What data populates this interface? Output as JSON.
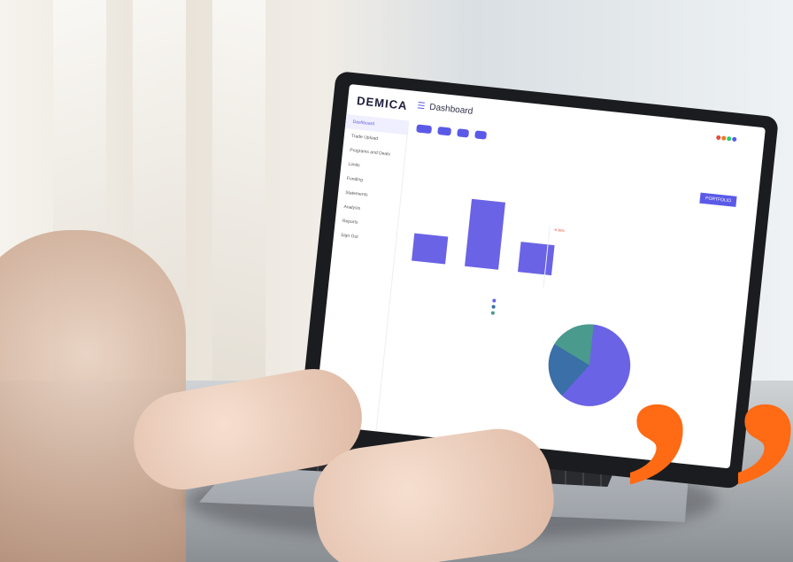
{
  "screen": {
    "logo": "DEMICA",
    "page_title": "Dashboard",
    "sidebar": [
      "Dashboard",
      "Trade Upload",
      "Programs and Deals",
      "Limits",
      "Funding",
      "Statements",
      "Analysis",
      "Reports",
      "Sign Out"
    ],
    "portfolio_button": "PORTFOLIO",
    "chart_bars": [
      0.35,
      0.85,
      0.38
    ],
    "ratio_highlight": "-8.36%"
  },
  "colors": {
    "accent": "#5b5ae8",
    "quote": "#ff6a14",
    "bar": "#6a63e6"
  },
  "icons": [
    "menu-icon",
    "quote-mark-icon"
  ]
}
